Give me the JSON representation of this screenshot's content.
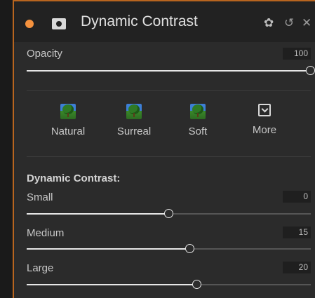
{
  "header": {
    "title": "Dynamic Contrast",
    "status_color": "#f5923e",
    "icons": [
      "mask-icon",
      "gear-icon",
      "undo-icon",
      "close-icon"
    ]
  },
  "opacity": {
    "label": "Opacity",
    "value": "100",
    "fraction": 1.0
  },
  "presets": [
    {
      "label": "Natural",
      "icon": "tree-thumbnail-icon"
    },
    {
      "label": "Surreal",
      "icon": "tree-thumbnail-icon"
    },
    {
      "label": "Soft",
      "icon": "tree-thumbnail-icon"
    },
    {
      "label": "More",
      "icon": "chevron-down-box-icon"
    }
  ],
  "dynamic_contrast": {
    "title": "Dynamic Contrast:",
    "sliders": [
      {
        "label": "Small",
        "value": "0",
        "fraction": 0.5
      },
      {
        "label": "Medium",
        "value": "15",
        "fraction": 0.575
      },
      {
        "label": "Large",
        "value": "20",
        "fraction": 0.6
      }
    ]
  }
}
